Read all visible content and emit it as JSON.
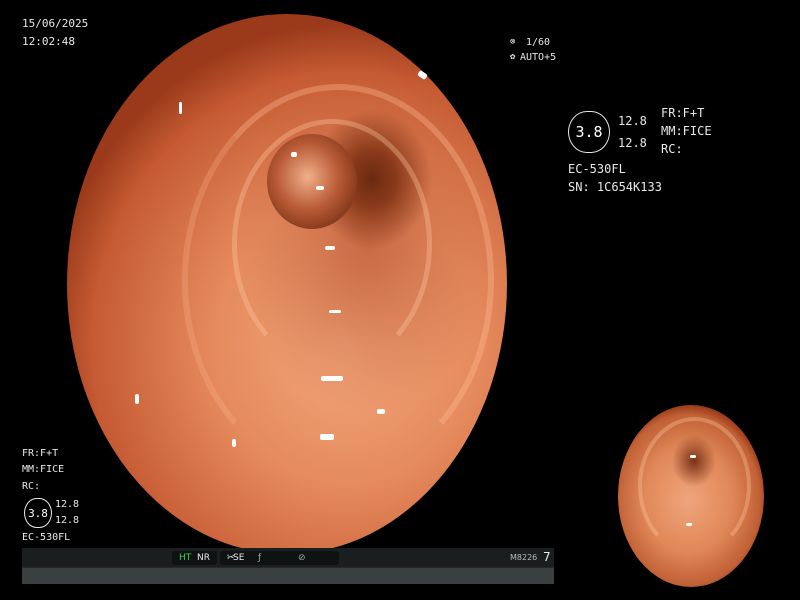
{
  "datetime": {
    "date": "15/06/2025",
    "time": "12:02:48"
  },
  "shutter": {
    "icon": "shutter-icon",
    "value": "1/60",
    "auto_icon": "iris-icon",
    "auto_value": "AUTO+5"
  },
  "scope_right": {
    "badge": "3.8",
    "val1": "12.8",
    "val2": "12.8",
    "fr": "FR:F+T",
    "mm": "MM:FICE",
    "rc": "RC:",
    "model": "EC-530FL",
    "serial": "SN: 1C654K133"
  },
  "scope_left": {
    "fr": "FR:F+T",
    "mm": "MM:FICE",
    "rc": "RC:",
    "badge": "3.8",
    "val1": "12.8",
    "val2": "12.8",
    "model": "EC-530FL"
  },
  "status": {
    "ht": "HT",
    "nr": "NR",
    "se": "SE",
    "code": "M8226",
    "num": "7",
    "ht_color": "#37d152",
    "icons": [
      "scissor-icon",
      "freeze-icon",
      "record-icon"
    ]
  }
}
